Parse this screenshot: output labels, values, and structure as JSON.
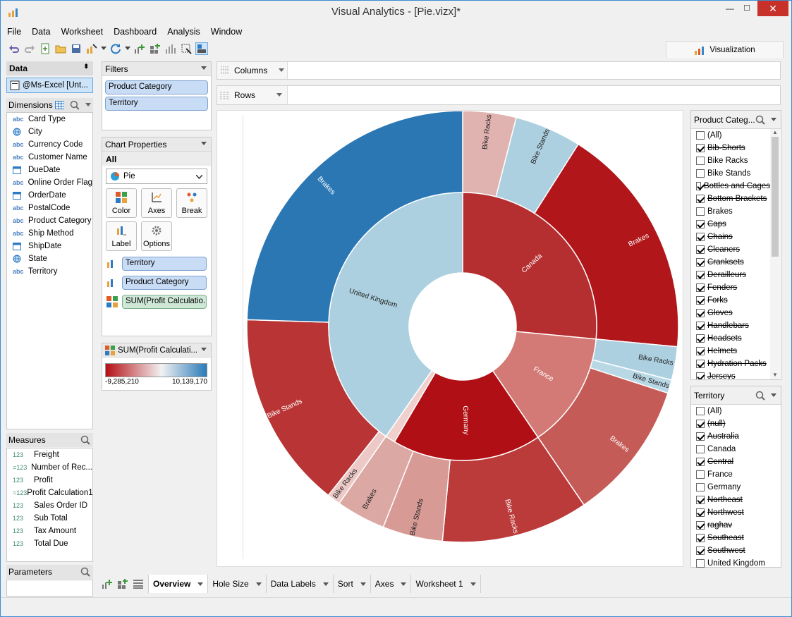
{
  "window": {
    "title": "Visual Analytics - [Pie.vizx]*",
    "minimize": "—",
    "maximize": "☐",
    "close": "✕"
  },
  "menu": [
    "File",
    "Data",
    "Worksheet",
    "Dashboard",
    "Analysis",
    "Window"
  ],
  "viz_tab": {
    "label": "Visualization"
  },
  "data_panel": {
    "title": "Data",
    "source": "@Ms-Excel [Unt..."
  },
  "dimensions": {
    "title": "Dimensions",
    "items": [
      {
        "label": "Card Type",
        "icon": "abc"
      },
      {
        "label": "City",
        "icon": "globe"
      },
      {
        "label": "Currency Code",
        "icon": "abc"
      },
      {
        "label": "Customer Name",
        "icon": "abc"
      },
      {
        "label": "DueDate",
        "icon": "calendar"
      },
      {
        "label": "Online Order Flag",
        "icon": "abc"
      },
      {
        "label": "OrderDate",
        "icon": "calendar"
      },
      {
        "label": "PostalCode",
        "icon": "abc"
      },
      {
        "label": "Product Category",
        "icon": "abc"
      },
      {
        "label": "Ship Method",
        "icon": "abc"
      },
      {
        "label": "ShipDate",
        "icon": "calendar"
      },
      {
        "label": "State",
        "icon": "globe"
      },
      {
        "label": "Territory",
        "icon": "abc"
      }
    ]
  },
  "measures": {
    "title": "Measures",
    "items": [
      {
        "label": "Freight",
        "icon": "123"
      },
      {
        "label": "Number of Rec...",
        "icon": "#123"
      },
      {
        "label": "Profit",
        "icon": "123"
      },
      {
        "label": "Profit Calculation1",
        "icon": "#123"
      },
      {
        "label": "Sales Order ID",
        "icon": "123"
      },
      {
        "label": "Sub Total",
        "icon": "123"
      },
      {
        "label": "Tax Amount",
        "icon": "123"
      },
      {
        "label": "Total Due",
        "icon": "123"
      }
    ]
  },
  "parameters": {
    "title": "Parameters"
  },
  "filters": {
    "title": "Filters",
    "items": [
      "Product Category",
      "Territory"
    ]
  },
  "chart_properties": {
    "title": "Chart Properties",
    "scope": "All",
    "chart_type": "Pie",
    "buttons": [
      "Color",
      "Axes",
      "Break",
      "Label",
      "Options"
    ],
    "fields": [
      {
        "label": "Territory",
        "kind": "dimension"
      },
      {
        "label": "Product Category",
        "kind": "dimension"
      },
      {
        "label": "SUM(Profit Calculatio...",
        "kind": "measure"
      }
    ]
  },
  "color_legend": {
    "title": "SUM(Profit Calculati...",
    "min": "-9,285,210",
    "max": "10,139,170",
    "colors": [
      "#b40f14",
      "#f2f2f2",
      "#2a7ab8"
    ]
  },
  "shelves": {
    "columns": "Columns",
    "rows": "Rows"
  },
  "product_filter": {
    "title": "Product Categ...",
    "items": [
      {
        "label": "(All)",
        "checked": false,
        "strike": false
      },
      {
        "label": "Bib-Shorts",
        "checked": true,
        "strike": true
      },
      {
        "label": "Bike Racks",
        "checked": false,
        "strike": false
      },
      {
        "label": "Bike Stands",
        "checked": false,
        "strike": false
      },
      {
        "label": "Bottles and Cages",
        "checked": true,
        "strike": true
      },
      {
        "label": "Bottom Brackets",
        "checked": true,
        "strike": true
      },
      {
        "label": "Brakes",
        "checked": false,
        "strike": false
      },
      {
        "label": "Caps",
        "checked": true,
        "strike": true
      },
      {
        "label": "Chains",
        "checked": true,
        "strike": true
      },
      {
        "label": "Cleaners",
        "checked": true,
        "strike": true
      },
      {
        "label": "Cranksets",
        "checked": true,
        "strike": true
      },
      {
        "label": "Derailleurs",
        "checked": true,
        "strike": true
      },
      {
        "label": "Fenders",
        "checked": true,
        "strike": true
      },
      {
        "label": "Forks",
        "checked": true,
        "strike": true
      },
      {
        "label": "Gloves",
        "checked": true,
        "strike": true
      },
      {
        "label": "Handlebars",
        "checked": true,
        "strike": true
      },
      {
        "label": "Headsets",
        "checked": true,
        "strike": true
      },
      {
        "label": "Helmets",
        "checked": true,
        "strike": true
      },
      {
        "label": "Hydration Packs",
        "checked": true,
        "strike": true
      },
      {
        "label": "Jerseys",
        "checked": true,
        "strike": true
      }
    ]
  },
  "territory_filter": {
    "title": "Territory",
    "items": [
      {
        "label": "(All)",
        "checked": false,
        "strike": false
      },
      {
        "label": "(null)",
        "checked": true,
        "strike": true
      },
      {
        "label": "Australia",
        "checked": true,
        "strike": true
      },
      {
        "label": "Canada",
        "checked": false,
        "strike": false
      },
      {
        "label": "Central",
        "checked": true,
        "strike": true
      },
      {
        "label": "France",
        "checked": false,
        "strike": false
      },
      {
        "label": "Germany",
        "checked": false,
        "strike": false
      },
      {
        "label": "Northeast",
        "checked": true,
        "strike": true
      },
      {
        "label": "Northwest",
        "checked": true,
        "strike": true
      },
      {
        "label": "raghav",
        "checked": true,
        "strike": true
      },
      {
        "label": "Southeast",
        "checked": true,
        "strike": true
      },
      {
        "label": "Southwest",
        "checked": true,
        "strike": true
      },
      {
        "label": "United Kingdom",
        "checked": false,
        "strike": false
      }
    ]
  },
  "bottom_tabs": [
    "Overview",
    "Hole Size",
    "Data Labels",
    "Sort",
    "Axes",
    "Worksheet 1"
  ],
  "chart_data": {
    "type": "pie",
    "subtype": "sunburst",
    "inner_ring": [
      {
        "label": "Canada",
        "share": 0.265,
        "color": "#b52f31"
      },
      {
        "label": "France",
        "share": 0.14,
        "color": "#d37a76"
      },
      {
        "label": "Germany",
        "share": 0.18,
        "color": "#b01015"
      },
      {
        "label": "",
        "share": 0.012,
        "color": "#f0d0cd"
      },
      {
        "label": "United Kingdom",
        "share": 0.403,
        "color": "#acd0e0"
      }
    ],
    "outer_ring": [
      {
        "label": "Bike Racks",
        "share": 0.04,
        "color": "#e0b3b0",
        "parent": "Canada"
      },
      {
        "label": "Bike Stands",
        "share": 0.05,
        "color": "#acd0e0",
        "parent": "Canada"
      },
      {
        "label": "Brakes",
        "share": 0.175,
        "color": "#b0161a",
        "parent": "Canada"
      },
      {
        "label": "Bike Racks",
        "share": 0.025,
        "color": "#acd0e0",
        "parent": "France"
      },
      {
        "label": "Bike Stands",
        "share": 0.01,
        "color": "#b8d8e6",
        "parent": "France"
      },
      {
        "label": "Brakes",
        "share": 0.105,
        "color": "#c55b57",
        "parent": "France"
      },
      {
        "label": "Bike Racks",
        "share": 0.11,
        "color": "#bb3a3a",
        "parent": "Germany"
      },
      {
        "label": "Bike Stands",
        "share": 0.045,
        "color": "#d79a95",
        "parent": "Germany"
      },
      {
        "label": "Brakes",
        "share": 0.037,
        "color": "#dba8a4",
        "parent": "Germany"
      },
      {
        "label": "Bike Racks",
        "share": 0.01,
        "color": "#ecc9c6",
        "parent": ""
      },
      {
        "label": "Bike Stands",
        "share": 0.148,
        "color": "#b93535",
        "parent": "United Kingdom"
      },
      {
        "label": "Brakes",
        "share": 0.245,
        "color": "#2a77b3",
        "parent": "United Kingdom"
      }
    ]
  }
}
